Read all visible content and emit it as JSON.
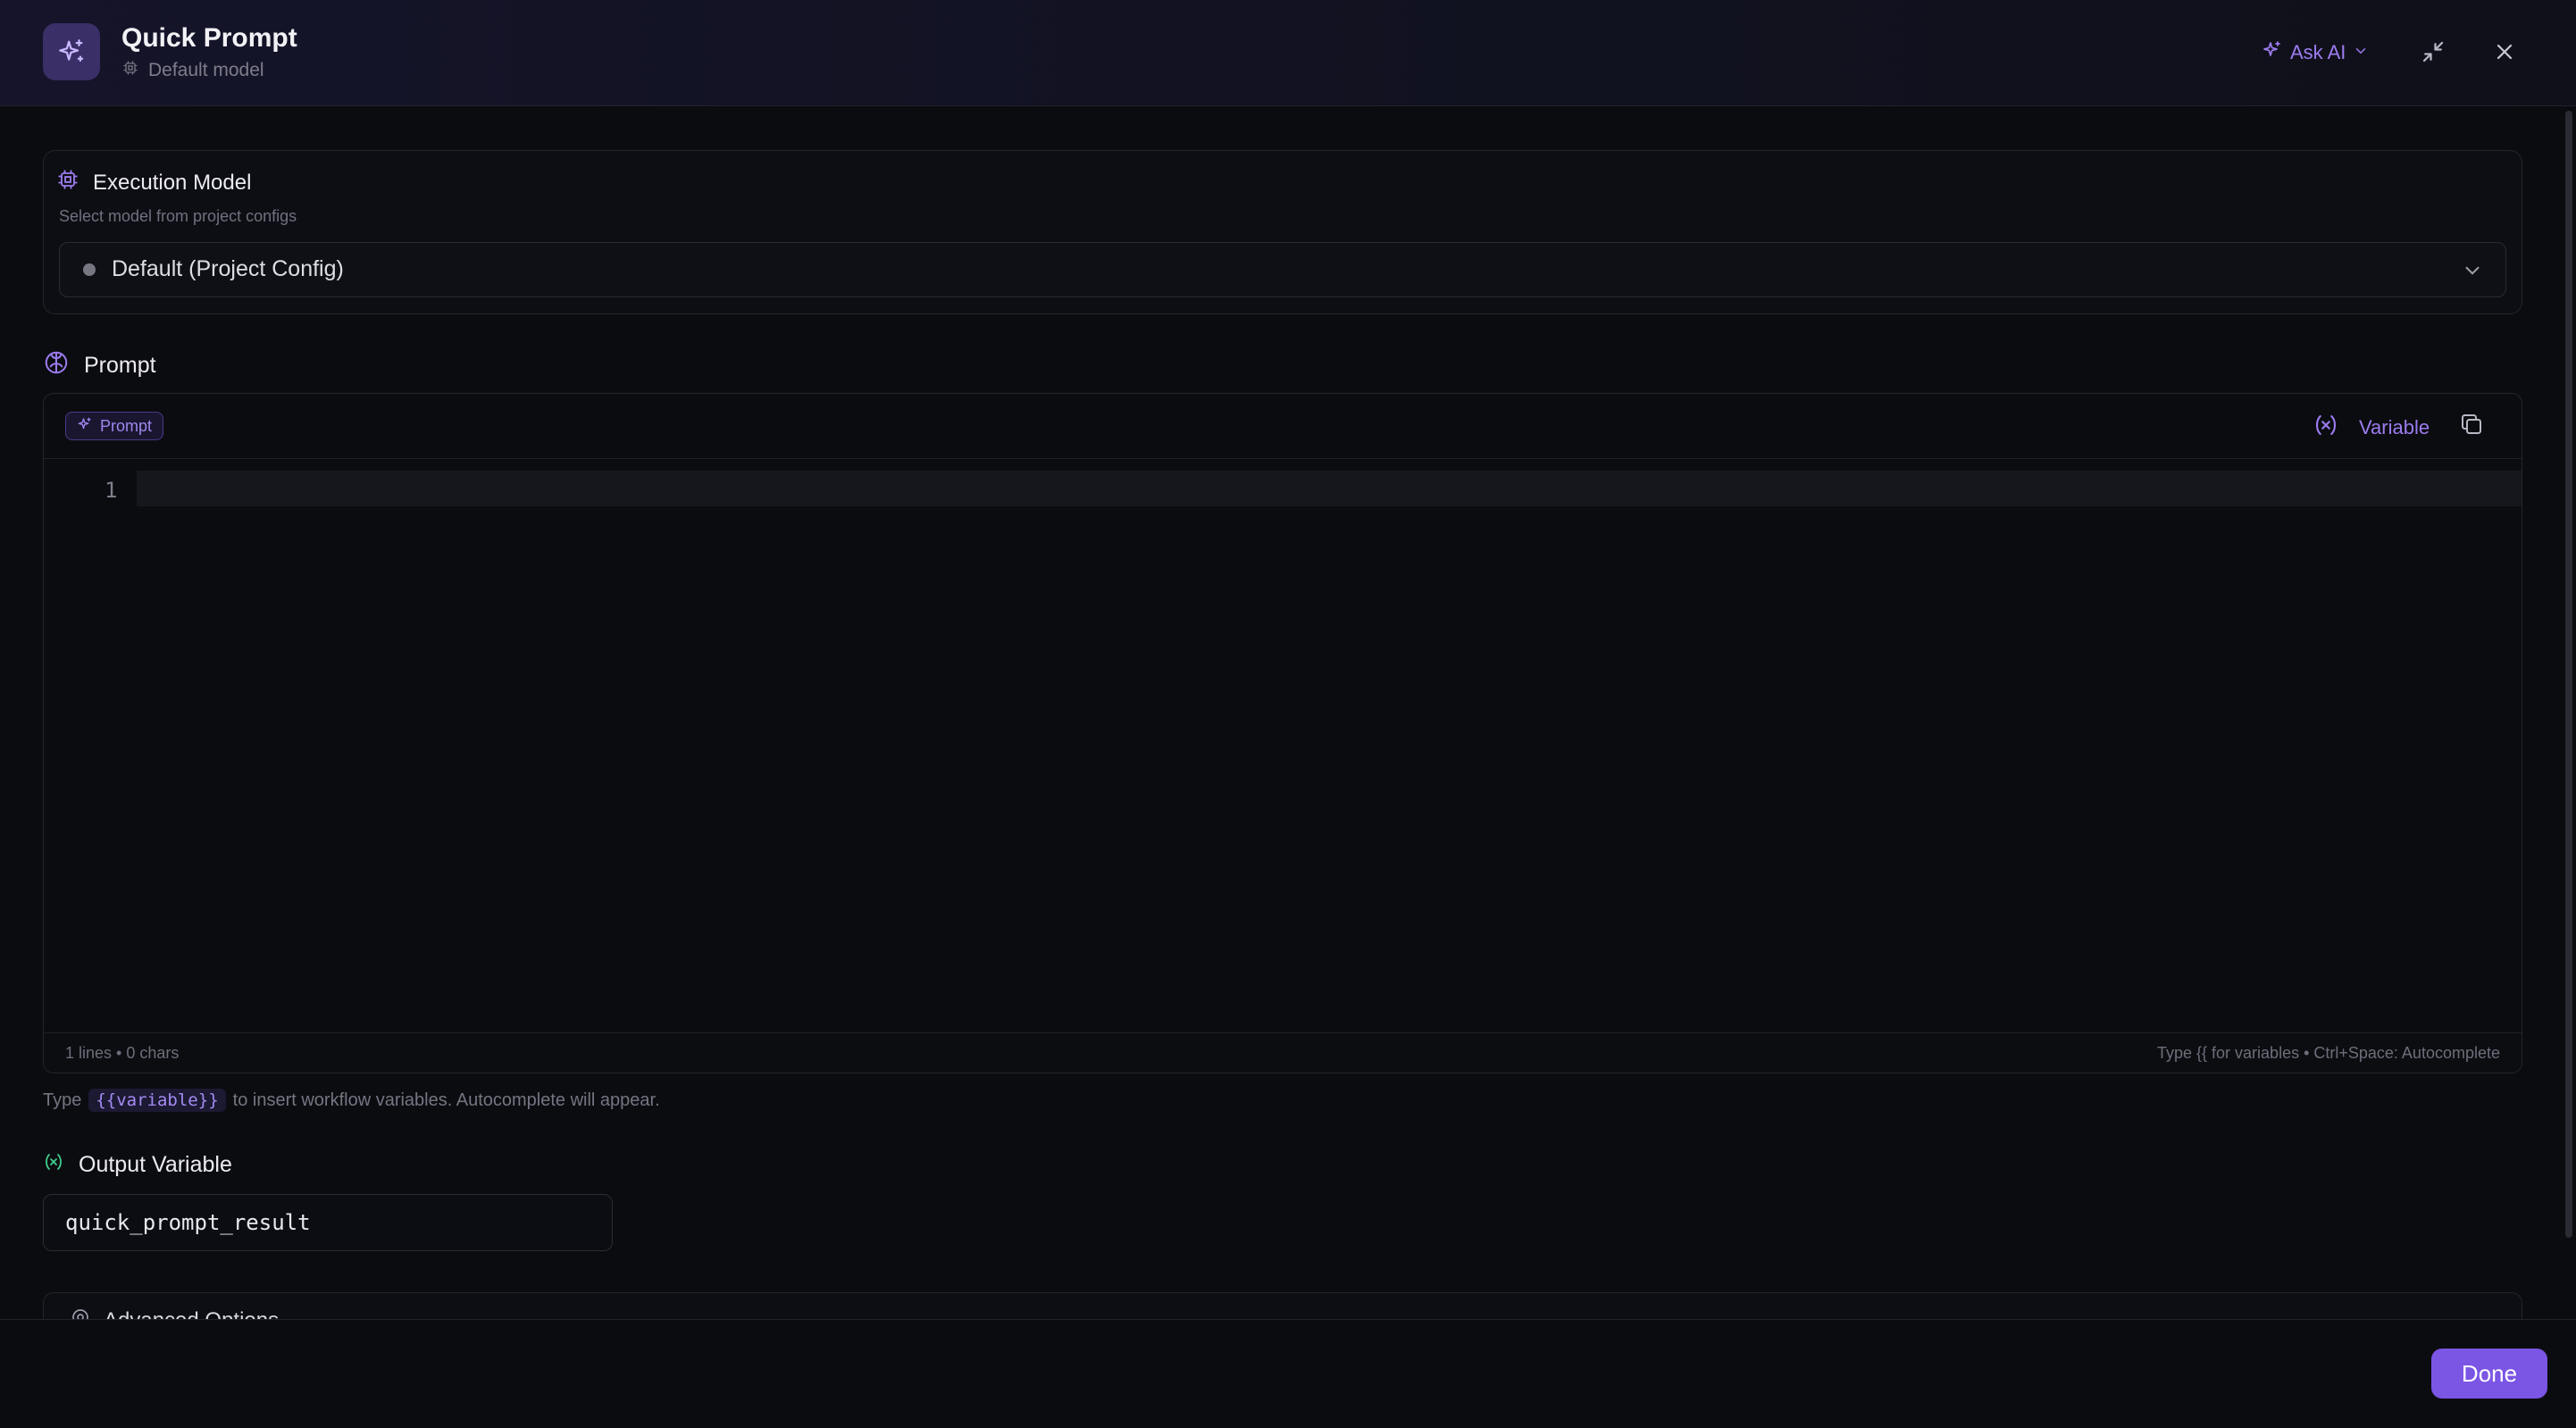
{
  "header": {
    "title": "Quick Prompt",
    "subtitle": "Default model",
    "ask_ai_label": "Ask AI",
    "icons": [
      "sparkle-icon",
      "chip-icon",
      "chevron-down-icon",
      "collapse-icon",
      "close-icon"
    ]
  },
  "execution_model": {
    "title": "Execution Model",
    "description": "Select model from project configs",
    "selected_value": "Default (Project Config)"
  },
  "prompt": {
    "heading": "Prompt",
    "chip_label": "Prompt",
    "variable_button_label": "Variable",
    "line_numbers": [
      "1"
    ],
    "stats": "1 lines • 0 chars",
    "shortcuts_hint": "Type {{ for variables • Ctrl+Space: Autocomplete",
    "hint_before": "Type",
    "hint_code": "{{variable}}",
    "hint_after": "to insert workflow variables. Autocomplete will appear."
  },
  "output_variable": {
    "heading": "Output Variable",
    "value": "quick_prompt_result"
  },
  "advanced": {
    "label": "Advanced Options"
  },
  "footer": {
    "done_label": "Done"
  },
  "colors": {
    "accent": "#7b55e4",
    "accent_text": "#9c7cf0",
    "background": "#0b0c10"
  }
}
